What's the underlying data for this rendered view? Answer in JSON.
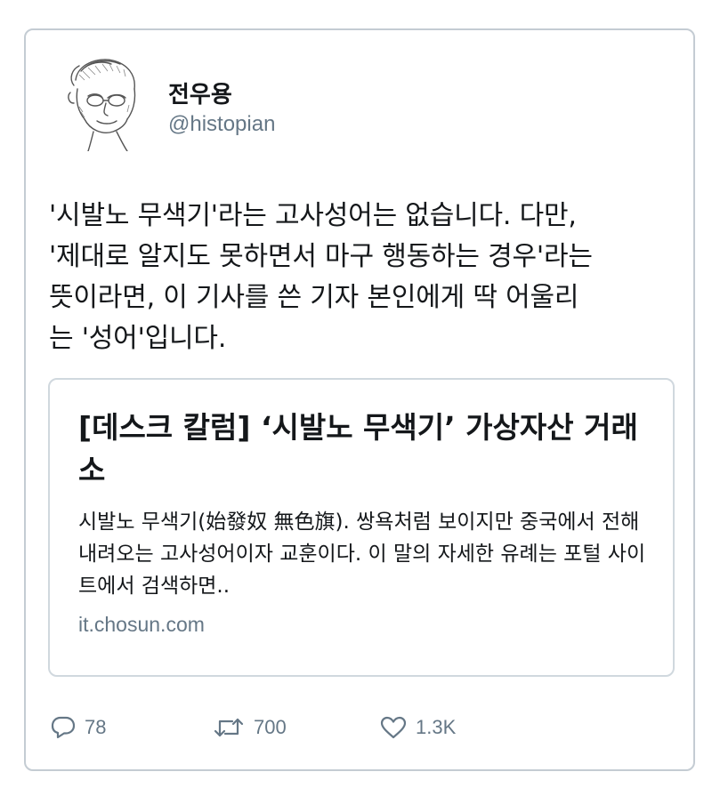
{
  "user": {
    "name": "전우용",
    "handle": "@histopian"
  },
  "tweet": {
    "text": "'시발노 무색기'라는 고사성어는 없습니다. 다만,\n'제대로 알지도 못하면서 마구 행동하는 경우'라는\n뜻이라면, 이 기사를 쓴 기자 본인에게 딱 어울리\n는 '성어'입니다."
  },
  "card": {
    "title": "[데스크 칼럼] ‘시발노 무색기’ 가상자산 거래소",
    "description": "시발노 무색기(始發奴 無色旗). 쌍욕처럼 보이지만 중국에서 전해 내려오는 고사성어이자 교훈이다. 이 말의 자세한 유례는 포털 사이트에서 검색하면..",
    "domain": "it.chosun.com"
  },
  "actions": {
    "replies": "78",
    "retweets": "700",
    "likes": "1.3K"
  },
  "icons": [
    "reply-icon",
    "retweet-icon",
    "heart-icon"
  ],
  "colors": {
    "text": "#14171a",
    "muted": "#657786",
    "border": "#c4ccd3"
  }
}
